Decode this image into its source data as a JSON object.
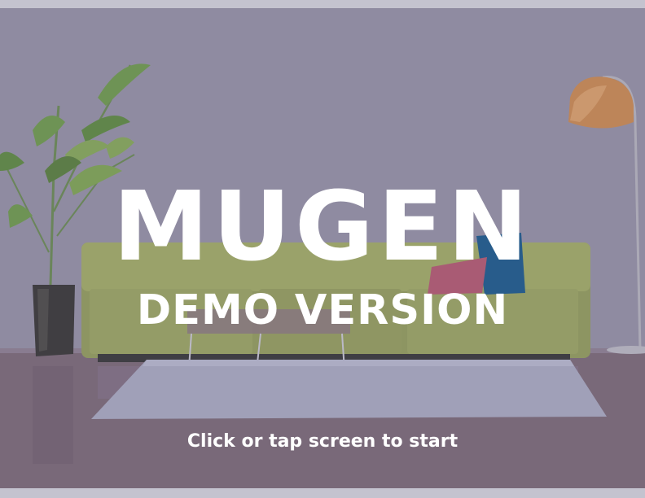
{
  "game": {
    "title": "MUGEN",
    "subtitle": "DEMO VERSION",
    "start_prompt": "Click or tap screen to start"
  },
  "colors": {
    "wall": "#9591a5",
    "floor": "#7d6b79",
    "sofa": "#9aa463",
    "pillow_blue": "#1f5c8c",
    "pillow_pink": "#b25a72",
    "lamp_shade": "#c98a54",
    "rug": "#a8a9c0",
    "text": "#ffffff"
  }
}
